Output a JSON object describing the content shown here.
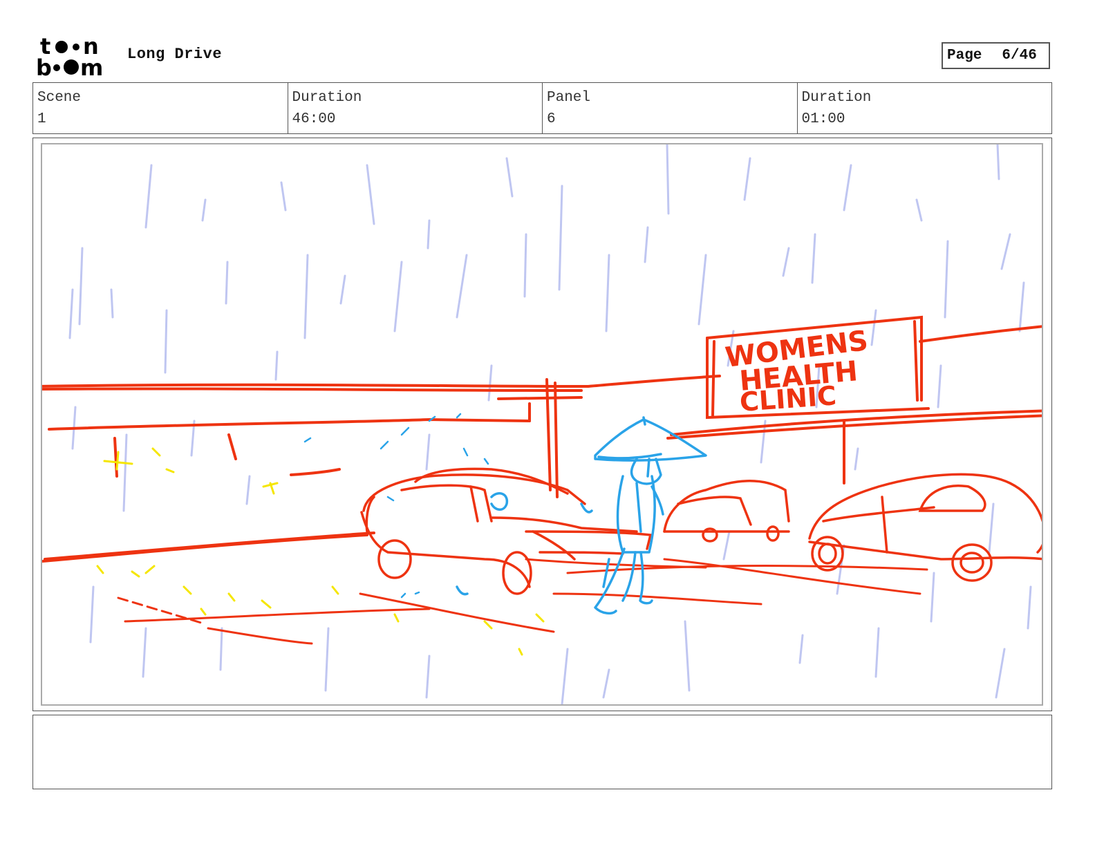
{
  "header": {
    "logo_text": "toon boom",
    "project_title": "Long Drive",
    "page_label": "Page",
    "page_value": "6/46"
  },
  "info": {
    "scene_label": "Scene",
    "scene_value": "1",
    "scene_duration_label": "Duration",
    "scene_duration_value": "46:00",
    "panel_label": "Panel",
    "panel_value": "6",
    "panel_duration_label": "Duration",
    "panel_duration_value": "01:00"
  },
  "panel": {
    "sign_text": [
      "WOMENS",
      "HEALTH",
      "CLINIC"
    ],
    "colors": {
      "sketch_red": "#ee3311",
      "figure_blue": "#2aa3e8",
      "rain": "#b9c0f0",
      "spark_yellow": "#f5e600"
    }
  },
  "notes": {
    "text": ""
  }
}
